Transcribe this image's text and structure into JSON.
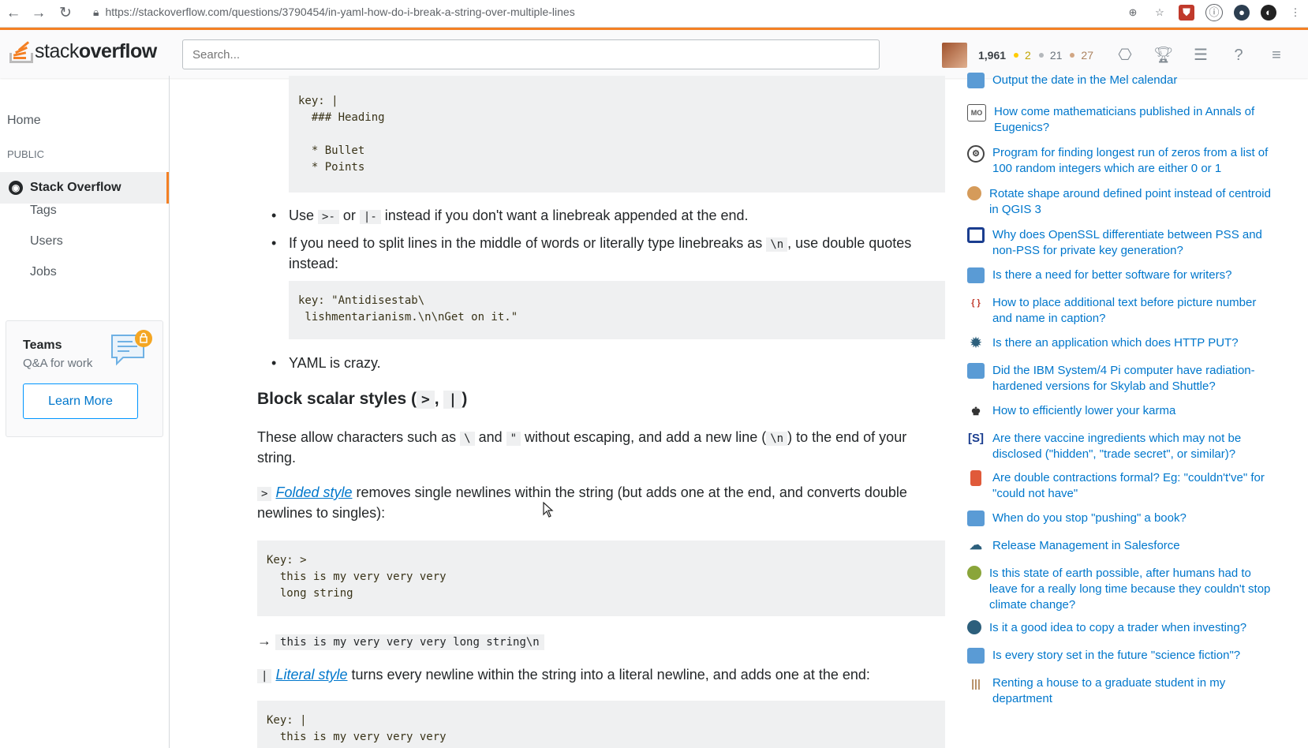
{
  "browser": {
    "url": "https://stackoverflow.com/questions/3790454/in-yaml-how-do-i-break-a-string-over-multiple-lines"
  },
  "topbar": {
    "logo_text_light": "stack",
    "logo_text_bold": "overflow",
    "search_placeholder": "Search...",
    "reputation": "1,961",
    "gold": "2",
    "silver": "21",
    "bronze": "27"
  },
  "sidebar": {
    "home": "Home",
    "public": "PUBLIC",
    "stackoverflow": "Stack Overflow",
    "tags": "Tags",
    "users": "Users",
    "jobs": "Jobs",
    "teams_title": "Teams",
    "teams_sub": "Q&A for work",
    "teams_button": "Learn More"
  },
  "main": {
    "code1": "key: |\n  ### Heading\n\n  * Bullet\n  * Points",
    "b1_pre": "Use ",
    "b1_code1": ">-",
    "b1_mid": " or ",
    "b1_code2": "|-",
    "b1_post": " instead if you don't want a linebreak appended at the end.",
    "b2_pre": "If you need to split lines in the middle of words or literally type linebreaks as ",
    "b2_code": "\\n",
    "b2_post": ", use double quotes instead:",
    "code2": "key: \"Antidisestab\\\n lishmentarianism.\\n\\nGet on it.\"",
    "b3": "YAML is crazy.",
    "h2_pre": "Block scalar styles (",
    "h2_code1": ">",
    "h2_sep": ", ",
    "h2_code2": "|",
    "h2_post": ")",
    "p1_a": "These allow characters such as ",
    "p1_c1": "\\",
    "p1_b": " and ",
    "p1_c2": "\"",
    "p1_c": " without escaping, and add a new line (",
    "p1_c3": "\\n",
    "p1_d": ") to the end of your string.",
    "folded_code": ">",
    "folded_link": "Folded style",
    "folded_text": " removes single newlines within the string (but adds one at the end, and converts double newlines to singles):",
    "code3": "Key: >\n  this is my very very very\n  long string",
    "arrow": "→",
    "result1": "this is my very very very long string\\n",
    "literal_code": "|",
    "literal_link": "Literal style",
    "literal_text": " turns every newline within the string into a literal newline, and adds one at the end:",
    "code4": "Key: |\n  this is my very very very"
  },
  "hot_questions": [
    {
      "title": "Output the date in the Mel calendar",
      "icon": "site-icon",
      "color": "#5a9bd5"
    },
    {
      "title": "How come mathematicians published in Annals of Eugenics?",
      "icon": "mo-icon",
      "color": "#555"
    },
    {
      "title": "Program for finding longest run of zeros from a list of 100 random integers which are either 0 or 1",
      "icon": "codegolf-icon",
      "color": "#444"
    },
    {
      "title": "Rotate shape around defined point instead of centroid in QGIS 3",
      "icon": "gis-icon",
      "color": "#d59b5a"
    },
    {
      "title": "Why does OpenSSL differentiate between PSS and non-PSS for private key generation?",
      "icon": "crypto-icon",
      "color": "#1a3d8f"
    },
    {
      "title": "Is there a need for better software for writers?",
      "icon": "softrec-icon",
      "color": "#5a9bd5"
    },
    {
      "title": "How to place additional text before picture number and name in caption?",
      "icon": "tex-icon",
      "color": "#c0392b"
    },
    {
      "title": "Is there an application which does HTTP PUT?",
      "icon": "superuser-icon",
      "color": "#2c5f7c"
    },
    {
      "title": "Did the IBM System/4 Pi computer have radiation-hardened versions for Skylab and Shuttle?",
      "icon": "retro-icon",
      "color": "#5a9bd5"
    },
    {
      "title": "How to efficiently lower your karma",
      "icon": "meta-icon",
      "color": "#333"
    },
    {
      "title": "Are there vaccine ingredients which may not be disclosed (\"hidden\", \"trade secret\", or similar)?",
      "icon": "skeptics-icon",
      "color": "#1a3d8f"
    },
    {
      "title": "Are double contractions formal? Eg: \"couldn't've\" for \"could not have\"",
      "icon": "ell-icon",
      "color": "#e05a3a"
    },
    {
      "title": "When do you stop \"pushing\" a book?",
      "icon": "writing-icon",
      "color": "#5a9bd5"
    },
    {
      "title": "Release Management in Salesforce",
      "icon": "salesforce-icon",
      "color": "#2c5f7c"
    },
    {
      "title": "Is this state of earth possible, after humans had to leave for a really long time because they couldn't stop climate change?",
      "icon": "worldbuilding-icon",
      "color": "#8aa53a"
    },
    {
      "title": "Is it a good idea to copy a trader when investing?",
      "icon": "money-icon",
      "color": "#2c5f7c"
    },
    {
      "title": "Is every story set in the future \"science fiction\"?",
      "icon": "literature-icon",
      "color": "#5a9bd5"
    },
    {
      "title": "Renting a house to a graduate student in my department",
      "icon": "academia-icon",
      "color": "#b0875a"
    }
  ]
}
